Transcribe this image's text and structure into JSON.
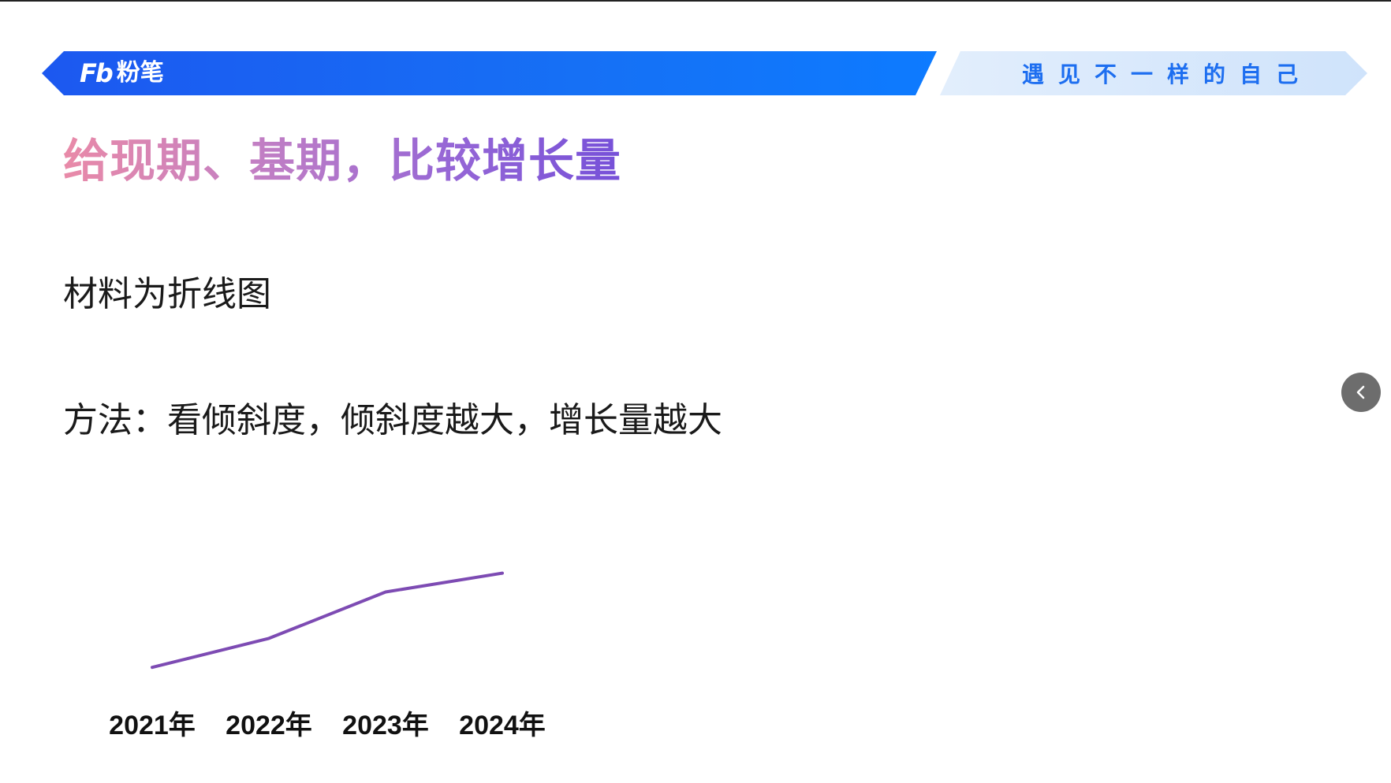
{
  "header": {
    "logo_mark": "Fb",
    "logo_text": "粉笔",
    "slogan": "遇见不一样的自己"
  },
  "title": "给现期、基期，比较增长量",
  "paragraphs": {
    "p1": "材料为折线图",
    "p2": "方法：看倾斜度，倾斜度越大，增长量越大"
  },
  "colors": {
    "banner_blue": "#1670f5",
    "slogan_blue": "#1d6ef0",
    "line_purple": "#7d4bb3"
  },
  "icons": {
    "nav": "chevron-left-icon"
  },
  "chart_data": {
    "type": "line",
    "categories": [
      "2021年",
      "2022年",
      "2023年",
      "2024年"
    ],
    "values": [
      1.0,
      2.0,
      3.6,
      4.25
    ],
    "ylim": [
      0,
      5
    ],
    "title": "",
    "xlabel": "",
    "ylabel": "",
    "grid": false,
    "axes_visible": false,
    "color": "#7d4bb3"
  }
}
